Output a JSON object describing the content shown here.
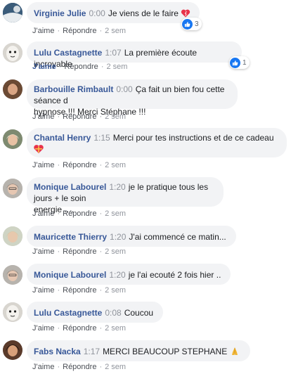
{
  "comments": [
    {
      "author": "Virginie Julie",
      "time": "0:00",
      "text": "Je viens de le faire",
      "reaction_count": "3",
      "emoji": "heart-icon"
    },
    {
      "author": "Lulu Castagnette",
      "time": "1:07",
      "text": "La première écoute incroyable",
      "reaction_count": "1"
    },
    {
      "author": "Barbouille Rimbault",
      "time": "0:00",
      "text_line1": "Ça fait un bien fou cette séance d",
      "text_line2": "hypnose !!! Merci Stéphane !!!"
    },
    {
      "author": "Chantal Henry",
      "time": "1:15",
      "text": "Merci pour tes instructions et de ce cadeau",
      "emoji": "gift-heart-icon"
    },
    {
      "author": "Monique Labourel",
      "time": "1:20",
      "text_line1": "je le pratique tous les jours + le soin",
      "text_line2": "energie ...."
    },
    {
      "author": "Mauricette Thierry",
      "time": "1:20",
      "text": "J'ai commencé ce matin..."
    },
    {
      "author": "Monique Labourel",
      "time": "1:20",
      "text": "je l'ai ecouté 2 fois hier .."
    },
    {
      "author": "Lulu Castagnette",
      "time": "0:08",
      "text": "Coucou"
    },
    {
      "author": "Fabs Nacka",
      "time": "1:17",
      "text": "MERCI BEAUCOUP STEPHANE",
      "emoji": "folded-hands-icon"
    }
  ],
  "actions": {
    "like": "J'aime",
    "reply": "Répondre",
    "age": "2 sem"
  },
  "colors": {
    "link": "#385898",
    "bubble": "#f2f3f5",
    "meta": "#90949c",
    "like_blue": "#1877f2"
  }
}
